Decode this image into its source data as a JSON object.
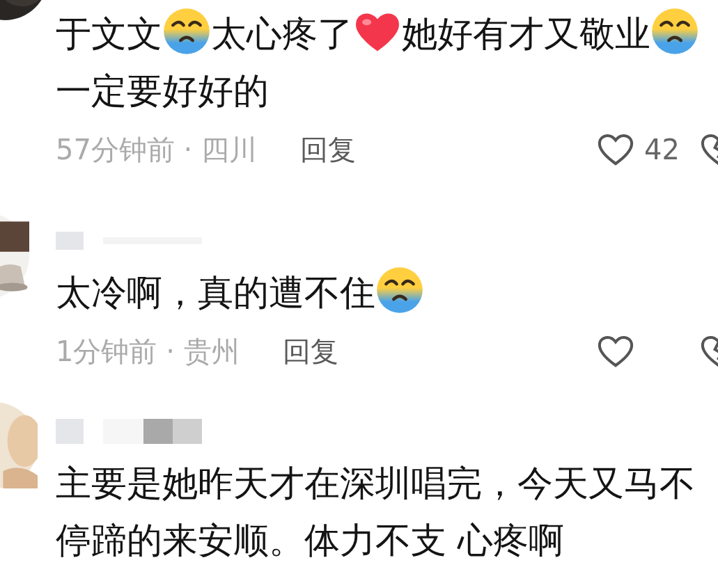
{
  "comments": [
    {
      "author_blurred": false,
      "text": [
        {
          "kind": "text",
          "text": "于文文"
        },
        {
          "kind": "crying"
        },
        {
          "kind": "text",
          "text": "太心疼了"
        },
        {
          "kind": "heart"
        },
        {
          "kind": "text",
          "text": "她好有才又敬业"
        },
        {
          "kind": "crying"
        },
        {
          "kind": "text",
          "text": "一定要好好的"
        }
      ],
      "meta": "57分钟前 · 四川",
      "reply": "回复",
      "likes": "42"
    },
    {
      "author_blurred": true,
      "text": [
        {
          "kind": "text",
          "text": "太冷啊，真的遭不住"
        },
        {
          "kind": "crying"
        }
      ],
      "meta": "1分钟前 · 贵州",
      "reply": "回复"
    },
    {
      "author_blurred": true,
      "text": [
        {
          "kind": "text",
          "text": "主要是她昨天才在深圳唱完，今天又马不停蹄的来安顺。体力不支 心疼啊"
        }
      ]
    }
  ]
}
